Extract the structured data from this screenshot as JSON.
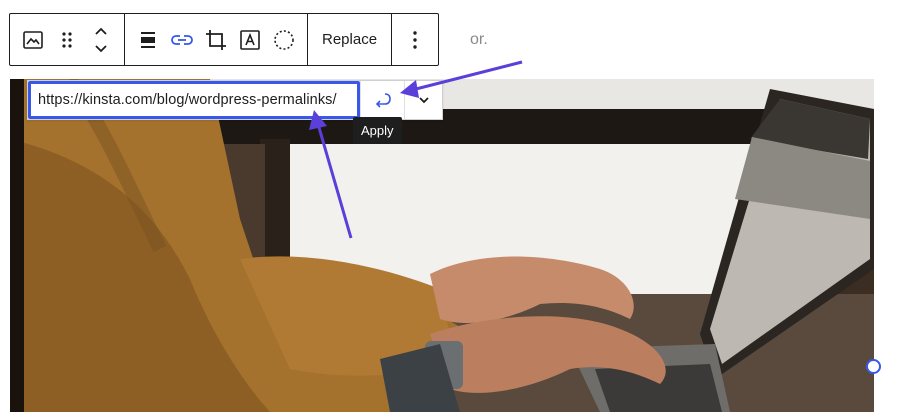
{
  "paragraph_fragment": "or.",
  "toolbar": {
    "icons": [
      "image-icon",
      "drag-handle-icon",
      "move-up-down-icon",
      "align-icon",
      "link-icon",
      "crop-icon",
      "text-overlay-icon",
      "duotone-icon",
      "more-options-icon"
    ],
    "replace_label": "Replace"
  },
  "link_popover": {
    "url_value": "https://kinsta.com/blog/wordpress-permalinks/",
    "apply_icon": "enter-return-icon",
    "toggle_icon": "chevron-down-icon"
  },
  "tooltip": {
    "text": "Apply"
  },
  "colors": {
    "accent": "#3858e9",
    "annotation_arrow": "#5b3fd9",
    "toolbar_border": "#1e1e1e"
  }
}
